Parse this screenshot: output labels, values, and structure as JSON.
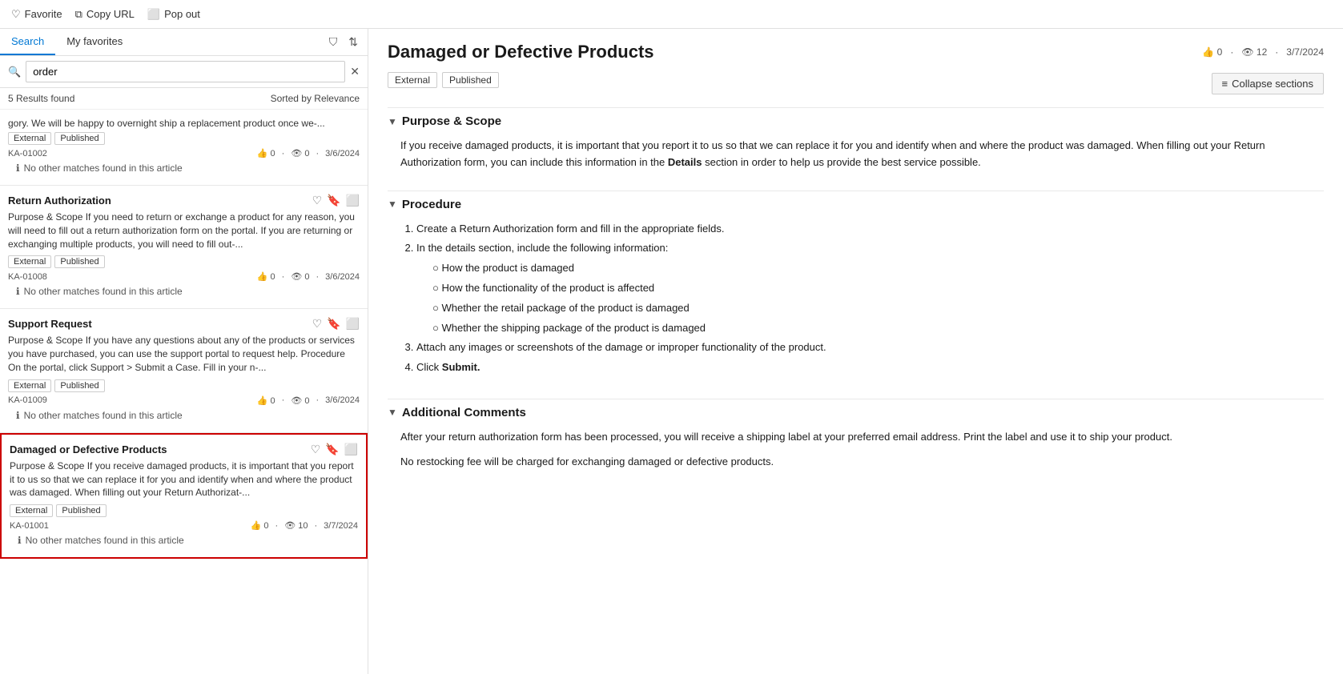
{
  "topbar": {
    "favorite_label": "Favorite",
    "copy_url_label": "Copy URL",
    "pop_out_label": "Pop out"
  },
  "search": {
    "tab_search": "Search",
    "tab_favorites": "My favorites",
    "input_value": "order",
    "results_count": "5 Results found",
    "sort_label": "Sorted by Relevance"
  },
  "results": [
    {
      "id": "result-1",
      "title": null,
      "excerpt_top": "gory. We will be happy to overnight ship a replacement product once we-...",
      "tags": [
        "External",
        "Published"
      ],
      "ka_id": "KA-01002",
      "likes": "0",
      "views": "0",
      "date": "3/6/2024",
      "no_match": "No other matches found in this article",
      "selected": false
    },
    {
      "id": "result-2",
      "title": "Return Authorization",
      "excerpt": "Purpose & Scope If you need to return or exchange a product for any reason, you will need to fill out a return authorization form on the portal. If you are returning or exchanging multiple products, you will need to fill out-...",
      "tags": [
        "External",
        "Published"
      ],
      "ka_id": "KA-01008",
      "likes": "0",
      "views": "0",
      "date": "3/6/2024",
      "no_match": "No other matches found in this article",
      "selected": false
    },
    {
      "id": "result-3",
      "title": "Support Request",
      "excerpt": "Purpose & Scope If you have any questions about any of the products or services you have purchased, you can use the support portal to request help. Procedure On the portal, click Support > Submit a Case. Fill in your n-...",
      "tags": [
        "External",
        "Published"
      ],
      "ka_id": "KA-01009",
      "likes": "0",
      "views": "0",
      "date": "3/6/2024",
      "no_match": "No other matches found in this article",
      "selected": false
    },
    {
      "id": "result-4",
      "title": "Damaged or Defective Products",
      "excerpt": "Purpose & Scope If you receive damaged products, it is important that you report it to us so that we can replace it for you and identify when and where the product was damaged. When filling out your Return Authorizat-...",
      "tags": [
        "External",
        "Published"
      ],
      "ka_id": "KA-01001",
      "likes": "0",
      "views": "10",
      "date": "3/7/2024",
      "no_match": "No other matches found in this article",
      "selected": true
    }
  ],
  "article": {
    "title": "Damaged or Defective Products",
    "tags": [
      "External",
      "Published"
    ],
    "likes": "0",
    "views": "12",
    "date": "3/7/2024",
    "collapse_sections": "Collapse sections",
    "sections": [
      {
        "id": "purpose",
        "title": "Purpose & Scope",
        "expanded": true,
        "body_html": "purpose_scope"
      },
      {
        "id": "procedure",
        "title": "Procedure",
        "expanded": true,
        "body_html": "procedure"
      },
      {
        "id": "comments",
        "title": "Additional Comments",
        "expanded": true,
        "body_html": "additional_comments"
      }
    ],
    "purpose_scope_text": "If you receive damaged products, it is important that you report it to us so that we can replace it for you and identify when and where the product was damaged. When filling out your Return Authorization form, you can include this information in the Details section in order to help us provide the best service possible.",
    "purpose_scope_bold": "Details",
    "procedure_steps": [
      "Create a Return Authorization form and fill in the appropriate fields.",
      "In the details section, include the following information:",
      "Attach any images or screenshots of the damage or improper functionality of the product.",
      "Click Submit."
    ],
    "procedure_substeps": [
      "How the product is damaged",
      "How the functionality of the product is affected",
      "Whether the retail package of the product is damaged",
      "Whether the shipping package of the product is damaged"
    ],
    "procedure_submit_bold": "Submit.",
    "additional_comments_1": "After your return authorization form has been processed, you will receive a shipping label at your preferred email address. Print the label and use it to ship your product.",
    "additional_comments_2": "No restocking fee will be charged for exchanging damaged or defective products."
  }
}
